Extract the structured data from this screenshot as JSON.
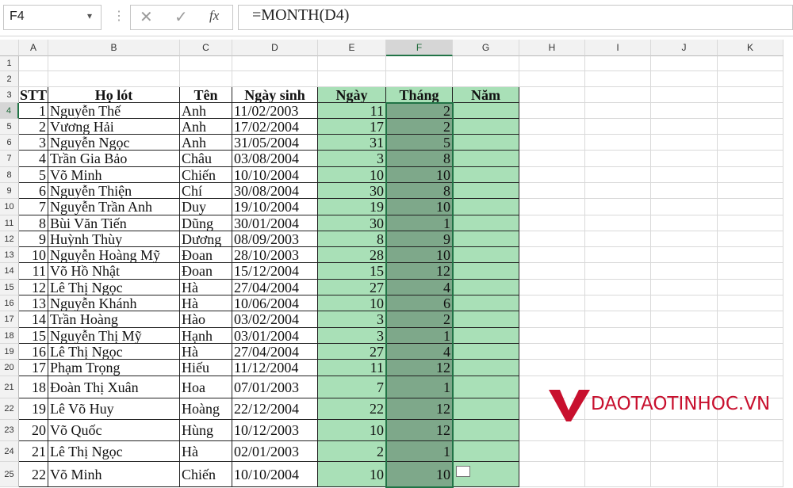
{
  "name_box": {
    "value": "F4"
  },
  "formula_bar": {
    "fx_label": "fx",
    "formula": "=MONTH(D4)"
  },
  "columns": [
    "A",
    "B",
    "C",
    "D",
    "E",
    "F",
    "G",
    "H",
    "I",
    "J",
    "K"
  ],
  "selected_column": "F",
  "header_row": {
    "row_number": "3",
    "cells": [
      "STT",
      "Họ lót",
      "Tên",
      "Ngày sinh",
      "Ngày",
      "Tháng",
      "Năm"
    ]
  },
  "empty_rows": [
    "1",
    "2"
  ],
  "rows": [
    {
      "n": "4",
      "stt": "1",
      "ho": "Nguyễn Thế",
      "ten": "Anh",
      "dob": "11/02/2003",
      "day": "11",
      "month": "2"
    },
    {
      "n": "5",
      "stt": "2",
      "ho": "Vương Hải",
      "ten": "Anh",
      "dob": "17/02/2004",
      "day": "17",
      "month": "2"
    },
    {
      "n": "6",
      "stt": "3",
      "ho": "Nguyễn Ngọc",
      "ten": "Anh",
      "dob": "31/05/2004",
      "day": "31",
      "month": "5"
    },
    {
      "n": "7",
      "stt": "4",
      "ho": "Trần Gia Bảo",
      "ten": "Châu",
      "dob": "03/08/2004",
      "day": "3",
      "month": "8"
    },
    {
      "n": "8",
      "stt": "5",
      "ho": "Võ Minh",
      "ten": "Chiến",
      "dob": "10/10/2004",
      "day": "10",
      "month": "10"
    },
    {
      "n": "9",
      "stt": "6",
      "ho": "Nguyễn Thiện",
      "ten": "Chí",
      "dob": "30/08/2004",
      "day": "30",
      "month": "8"
    },
    {
      "n": "10",
      "stt": "7",
      "ho": "Nguyễn Trần Anh",
      "ten": "Duy",
      "dob": "19/10/2004",
      "day": "19",
      "month": "10"
    },
    {
      "n": "11",
      "stt": "8",
      "ho": "Bùi Văn Tiến",
      "ten": "Dũng",
      "dob": "30/01/2004",
      "day": "30",
      "month": "1"
    },
    {
      "n": "12",
      "stt": "9",
      "ho": "Huỳnh Thùy",
      "ten": "Dương",
      "dob": "08/09/2003",
      "day": "8",
      "month": "9"
    },
    {
      "n": "13",
      "stt": "10",
      "ho": "Nguyễn Hoàng Mỹ",
      "ten": "Đoan",
      "dob": "28/10/2003",
      "day": "28",
      "month": "10"
    },
    {
      "n": "14",
      "stt": "11",
      "ho": "Võ Hồ Nhật",
      "ten": "Đoan",
      "dob": "15/12/2004",
      "day": "15",
      "month": "12"
    },
    {
      "n": "15",
      "stt": "12",
      "ho": "Lê Thị Ngọc",
      "ten": "Hà",
      "dob": "27/04/2004",
      "day": "27",
      "month": "4"
    },
    {
      "n": "16",
      "stt": "13",
      "ho": "Nguyễn Khánh",
      "ten": "Hà",
      "dob": "10/06/2004",
      "day": "10",
      "month": "6"
    },
    {
      "n": "17",
      "stt": "14",
      "ho": "Trần Hoàng",
      "ten": "Hào",
      "dob": "03/02/2004",
      "day": "3",
      "month": "2"
    },
    {
      "n": "18",
      "stt": "15",
      "ho": "Nguyễn Thị Mỹ",
      "ten": "Hạnh",
      "dob": "03/01/2004",
      "day": "3",
      "month": "1"
    },
    {
      "n": "19",
      "stt": "16",
      "ho": "Lê Thị Ngọc",
      "ten": "Hà",
      "dob": "27/04/2004",
      "day": "27",
      "month": "4"
    },
    {
      "n": "20",
      "stt": "17",
      "ho": "Phạm Trọng",
      "ten": "Hiếu",
      "dob": "11/12/2004",
      "day": "11",
      "month": "12"
    },
    {
      "n": "21",
      "stt": "18",
      "ho": "Đoàn Thị Xuân",
      "ten": "Hoa",
      "dob": "07/01/2003",
      "day": "7",
      "month": "1"
    },
    {
      "n": "22",
      "stt": "19",
      "ho": "Lê Võ Huy",
      "ten": "Hoàng",
      "dob": "22/12/2004",
      "day": "22",
      "month": "12"
    },
    {
      "n": "23",
      "stt": "20",
      "ho": "Võ Quốc",
      "ten": "Hùng",
      "dob": "10/12/2003",
      "day": "10",
      "month": "12"
    },
    {
      "n": "24",
      "stt": "21",
      "ho": "Lê Thị Ngọc",
      "ten": "Hà",
      "dob": "02/01/2003",
      "day": "2",
      "month": "1"
    },
    {
      "n": "25",
      "stt": "22",
      "ho": "Võ Minh",
      "ten": "Chiến",
      "dob": "10/10/2004",
      "day": "10",
      "month": "10"
    }
  ],
  "colors": {
    "green_fill": "#a9e0b7",
    "selected_fill": "#7ea88a",
    "excel_green": "#217346",
    "logo_red": "#c8102e"
  },
  "watermark": {
    "text": "DAOTAOTINHOC.VN"
  }
}
